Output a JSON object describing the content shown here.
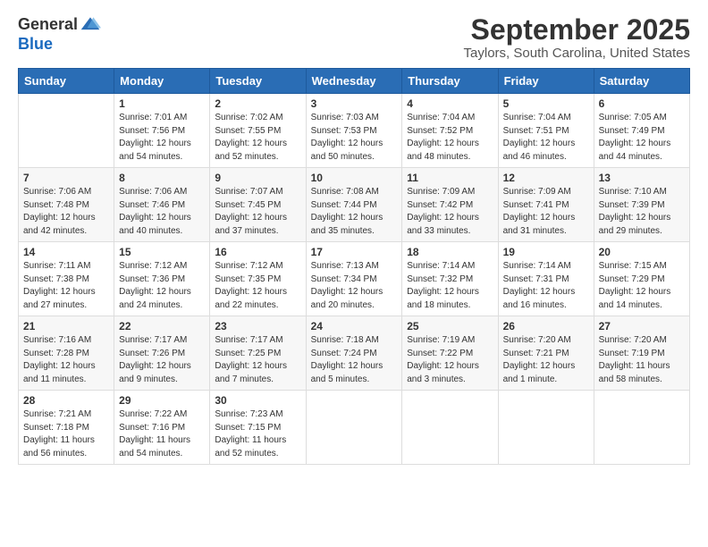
{
  "header": {
    "logo_general": "General",
    "logo_blue": "Blue",
    "month": "September 2025",
    "location": "Taylors, South Carolina, United States"
  },
  "days_of_week": [
    "Sunday",
    "Monday",
    "Tuesday",
    "Wednesday",
    "Thursday",
    "Friday",
    "Saturday"
  ],
  "weeks": [
    [
      null,
      {
        "day": 1,
        "sunrise": "7:01 AM",
        "sunset": "7:56 PM",
        "daylight": "12 hours and 54 minutes."
      },
      {
        "day": 2,
        "sunrise": "7:02 AM",
        "sunset": "7:55 PM",
        "daylight": "12 hours and 52 minutes."
      },
      {
        "day": 3,
        "sunrise": "7:03 AM",
        "sunset": "7:53 PM",
        "daylight": "12 hours and 50 minutes."
      },
      {
        "day": 4,
        "sunrise": "7:04 AM",
        "sunset": "7:52 PM",
        "daylight": "12 hours and 48 minutes."
      },
      {
        "day": 5,
        "sunrise": "7:04 AM",
        "sunset": "7:51 PM",
        "daylight": "12 hours and 46 minutes."
      },
      {
        "day": 6,
        "sunrise": "7:05 AM",
        "sunset": "7:49 PM",
        "daylight": "12 hours and 44 minutes."
      }
    ],
    [
      {
        "day": 7,
        "sunrise": "7:06 AM",
        "sunset": "7:48 PM",
        "daylight": "12 hours and 42 minutes."
      },
      {
        "day": 8,
        "sunrise": "7:06 AM",
        "sunset": "7:46 PM",
        "daylight": "12 hours and 40 minutes."
      },
      {
        "day": 9,
        "sunrise": "7:07 AM",
        "sunset": "7:45 PM",
        "daylight": "12 hours and 37 minutes."
      },
      {
        "day": 10,
        "sunrise": "7:08 AM",
        "sunset": "7:44 PM",
        "daylight": "12 hours and 35 minutes."
      },
      {
        "day": 11,
        "sunrise": "7:09 AM",
        "sunset": "7:42 PM",
        "daylight": "12 hours and 33 minutes."
      },
      {
        "day": 12,
        "sunrise": "7:09 AM",
        "sunset": "7:41 PM",
        "daylight": "12 hours and 31 minutes."
      },
      {
        "day": 13,
        "sunrise": "7:10 AM",
        "sunset": "7:39 PM",
        "daylight": "12 hours and 29 minutes."
      }
    ],
    [
      {
        "day": 14,
        "sunrise": "7:11 AM",
        "sunset": "7:38 PM",
        "daylight": "12 hours and 27 minutes."
      },
      {
        "day": 15,
        "sunrise": "7:12 AM",
        "sunset": "7:36 PM",
        "daylight": "12 hours and 24 minutes."
      },
      {
        "day": 16,
        "sunrise": "7:12 AM",
        "sunset": "7:35 PM",
        "daylight": "12 hours and 22 minutes."
      },
      {
        "day": 17,
        "sunrise": "7:13 AM",
        "sunset": "7:34 PM",
        "daylight": "12 hours and 20 minutes."
      },
      {
        "day": 18,
        "sunrise": "7:14 AM",
        "sunset": "7:32 PM",
        "daylight": "12 hours and 18 minutes."
      },
      {
        "day": 19,
        "sunrise": "7:14 AM",
        "sunset": "7:31 PM",
        "daylight": "12 hours and 16 minutes."
      },
      {
        "day": 20,
        "sunrise": "7:15 AM",
        "sunset": "7:29 PM",
        "daylight": "12 hours and 14 minutes."
      }
    ],
    [
      {
        "day": 21,
        "sunrise": "7:16 AM",
        "sunset": "7:28 PM",
        "daylight": "12 hours and 11 minutes."
      },
      {
        "day": 22,
        "sunrise": "7:17 AM",
        "sunset": "7:26 PM",
        "daylight": "12 hours and 9 minutes."
      },
      {
        "day": 23,
        "sunrise": "7:17 AM",
        "sunset": "7:25 PM",
        "daylight": "12 hours and 7 minutes."
      },
      {
        "day": 24,
        "sunrise": "7:18 AM",
        "sunset": "7:24 PM",
        "daylight": "12 hours and 5 minutes."
      },
      {
        "day": 25,
        "sunrise": "7:19 AM",
        "sunset": "7:22 PM",
        "daylight": "12 hours and 3 minutes."
      },
      {
        "day": 26,
        "sunrise": "7:20 AM",
        "sunset": "7:21 PM",
        "daylight": "12 hours and 1 minute."
      },
      {
        "day": 27,
        "sunrise": "7:20 AM",
        "sunset": "7:19 PM",
        "daylight": "11 hours and 58 minutes."
      }
    ],
    [
      {
        "day": 28,
        "sunrise": "7:21 AM",
        "sunset": "7:18 PM",
        "daylight": "11 hours and 56 minutes."
      },
      {
        "day": 29,
        "sunrise": "7:22 AM",
        "sunset": "7:16 PM",
        "daylight": "11 hours and 54 minutes."
      },
      {
        "day": 30,
        "sunrise": "7:23 AM",
        "sunset": "7:15 PM",
        "daylight": "11 hours and 52 minutes."
      },
      null,
      null,
      null,
      null
    ]
  ]
}
